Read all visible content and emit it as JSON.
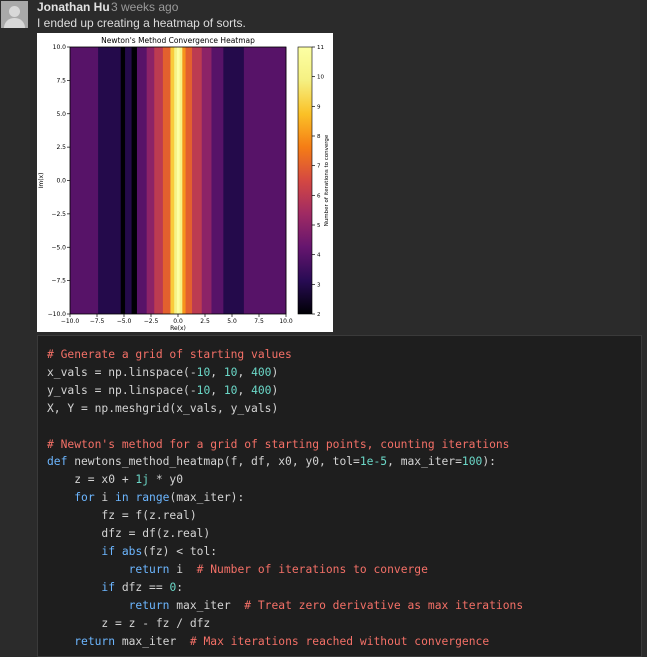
{
  "comment": {
    "author": "Jonathan Hu",
    "time": "3 weeks ago",
    "text": "I ended up creating a heatmap of sorts."
  },
  "chart_data": {
    "type": "heatmap",
    "title": "Newton's Method Convergence Heatmap",
    "xlabel": "Re(x)",
    "ylabel": "Im(x)",
    "xlim": [
      -10,
      10
    ],
    "ylim": [
      -10,
      10
    ],
    "xticks": [
      "−10.0",
      "−7.5",
      "−5.0",
      "−2.5",
      "0.0",
      "2.5",
      "5.0",
      "7.5",
      "10.0"
    ],
    "yticks": [
      "10.0",
      "7.5",
      "5.0",
      "2.5",
      "0.0",
      "−2.5",
      "−5.0",
      "−7.5",
      "−10.0"
    ],
    "colorbar_label": "Number of iterations to converge",
    "colorbar_ticks": [
      "11",
      "10",
      "9",
      "8",
      "7",
      "6",
      "5",
      "4",
      "3",
      "2"
    ],
    "colormap": "inferno",
    "color_range": [
      2,
      11
    ],
    "columns": [
      {
        "x0": -10.0,
        "x1": -7.4,
        "value": 4
      },
      {
        "x0": -7.4,
        "x1": -5.3,
        "value": 3
      },
      {
        "x0": -5.3,
        "x1": -4.9,
        "value": 2
      },
      {
        "x0": -4.9,
        "x1": -4.3,
        "value": 3
      },
      {
        "x0": -4.3,
        "x1": -3.8,
        "value": 2
      },
      {
        "x0": -3.8,
        "x1": -2.9,
        "value": 4
      },
      {
        "x0": -2.9,
        "x1": -2.2,
        "value": 5
      },
      {
        "x0": -2.2,
        "x1": -1.4,
        "value": 6
      },
      {
        "x0": -1.4,
        "x1": -0.7,
        "value": 7
      },
      {
        "x0": -0.7,
        "x1": -0.35,
        "value": 9
      },
      {
        "x0": -0.35,
        "x1": -0.1,
        "value": 10
      },
      {
        "x0": -0.1,
        "x1": 0.15,
        "value": 11
      },
      {
        "x0": 0.15,
        "x1": 0.4,
        "value": 10
      },
      {
        "x0": 0.4,
        "x1": 0.7,
        "value": 8
      },
      {
        "x0": 0.7,
        "x1": 1.3,
        "value": 7
      },
      {
        "x0": 1.3,
        "x1": 2.2,
        "value": 6
      },
      {
        "x0": 2.2,
        "x1": 3.1,
        "value": 5
      },
      {
        "x0": 3.1,
        "x1": 4.2,
        "value": 4
      },
      {
        "x0": 4.2,
        "x1": 6.1,
        "value": 3
      },
      {
        "x0": 6.1,
        "x1": 10.0,
        "value": 4
      }
    ]
  },
  "code_lines": [
    "# Generate a grid of starting values",
    "x_vals = np.linspace(-10, 10, 400)",
    "y_vals = np.linspace(-10, 10, 400)",
    "X, Y = np.meshgrid(x_vals, y_vals)",
    "",
    "# Newton's method for a grid of starting points, counting iterations",
    "def newtons_method_heatmap(f, df, x0, y0, tol=1e-5, max_iter=100):",
    "    z = x0 + 1j * y0",
    "    for i in range(max_iter):",
    "        fz = f(z.real)",
    "        dfz = df(z.real)",
    "        if abs(fz) < tol:",
    "            return i  # Number of iterations to converge",
    "        if dfz == 0:",
    "            return max_iter  # Treat zero derivative as max iterations",
    "        z = z - fz / dfz",
    "    return max_iter  # Max iterations reached without convergence"
  ],
  "colors": {
    "comment": "#f47067",
    "keyword": "#6cb6ff",
    "number": "#6bd8c8",
    "function": "#dcdcaa",
    "text": "#d4d4d4"
  }
}
